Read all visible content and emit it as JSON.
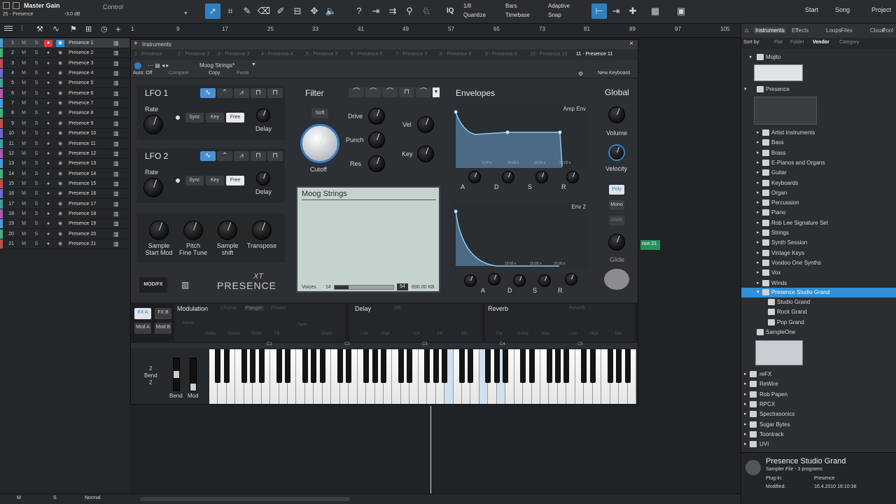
{
  "topbar": {
    "channel": "Master Gain",
    "track": "25 - Presence",
    "db": "-3.0 dB",
    "control": "Control",
    "quantize_val": "1/8",
    "quantize": "Quantize",
    "timebase_val": "Bars",
    "timebase": "Timebase",
    "snap_val": "Adaptive",
    "snap": "Snap",
    "iq": "IQ",
    "start": "Start",
    "song": "Song",
    "project": "Project"
  },
  "ruler": [
    "1",
    "9",
    "17",
    "25",
    "33",
    "41",
    "49",
    "57",
    "65",
    "73",
    "81",
    "89",
    "97",
    "105"
  ],
  "tracks": [
    "Presence 1",
    "Presence 2",
    "Presence 3",
    "Presence 4",
    "Presence 5",
    "Presence 6",
    "Presence 7",
    "Presence 8",
    "Presence 9",
    "Presence 10",
    "Presence 11",
    "Presence 12",
    "Presence 13",
    "Presence 14",
    "Presence 15",
    "Presence 16",
    "Presence 17",
    "Presence 18",
    "Presence 19",
    "Presence 20",
    "Presence 21"
  ],
  "track_nums": [
    "1",
    "2",
    "3",
    "4",
    "5",
    "6",
    "7",
    "8",
    "9",
    "10",
    "11",
    "12",
    "13",
    "14",
    "15",
    "16",
    "17",
    "18",
    "19",
    "20",
    "21"
  ],
  "instwin": {
    "title": "Instruments",
    "tabs": [
      "1 - Presence",
      "2 - Presence 2",
      "3 - Presence 3",
      "4 - Presence 4",
      "5 - Presence 5",
      "6 - Presence 6",
      "7 - Presence 7",
      "8 - Presence 8",
      "9 - Presence 9",
      "10 - Presence 10",
      "11 - Presence 11"
    ],
    "preset": "Moog Strings*",
    "auto_off": "Auto: Off",
    "compare": "Compare",
    "copy": "Copy",
    "paste": "Paste",
    "new_keyboard": "New Keyboard"
  },
  "lfo1": {
    "title": "LFO 1",
    "rate": "Rate",
    "sync": "Sync",
    "key": "Key",
    "free": "Free",
    "delay": "Delay"
  },
  "lfo2": {
    "title": "LFO 2",
    "rate": "Rate",
    "sync": "Sync",
    "key": "Key",
    "free": "Free",
    "delay": "Delay"
  },
  "sample": {
    "start_mod": "Sample\nStart Mod",
    "pitch": "Pitch\nFine Tune",
    "shift": "Sample\nshift",
    "transpose": "Transpose"
  },
  "filter": {
    "title": "Filter",
    "soft": "Soft",
    "drive": "Drive",
    "punch": "Punch",
    "res": "Res",
    "cutoff": "Cutoff",
    "vel": "Vel",
    "key": "Key"
  },
  "display": {
    "name": "Moog Strings",
    "voices_label": "Voices",
    "voices": "14",
    "voices_max": "64",
    "size": "690.00 KB"
  },
  "brand": {
    "modfx": "MOD/FX",
    "xt": "XT",
    "presence": "PRESENCE"
  },
  "envelopes": {
    "title": "Envelopes",
    "amp": "Amp Env",
    "env2": "Env 2",
    "ticks": [
      "5.00 s",
      "10.00 s",
      "15.00 s",
      "20.00 s"
    ],
    "a": "A",
    "d": "D",
    "s": "S",
    "r": "R"
  },
  "global": {
    "title": "Global",
    "volume": "Volume",
    "velocity": "Velocity",
    "poly": "Poly",
    "mono": "Mono",
    "glide": "Glide",
    "glide2": "Glide"
  },
  "fx": {
    "fxa": "FX A",
    "fxb": "FX B",
    "moda": "Mod A",
    "modb": "Mod B",
    "modulation": "Modulation",
    "chorus": "Chorus",
    "flanger": "Flanger",
    "phaser": "Phaser",
    "mod_knobs": [
      "Mono",
      "Delay",
      "Speed",
      "Width",
      "FB",
      "Depth"
    ],
    "sync": "Sync",
    "delay": "Delay",
    "delay_off": "Off",
    "delay_knobs": [
      "Low",
      "High",
      "1/4",
      "FB",
      "Mix"
    ],
    "reverb": "Reverb",
    "rev_mode": "Reverb",
    "rev_knobs": [
      "Pre",
      "Damp",
      "Size",
      "Low",
      "High",
      "Mix"
    ]
  },
  "keyboard": {
    "bend_range_top": "2",
    "bend_range_label": "Bend",
    "bend_range_bottom": "2",
    "bend": "Bend",
    "mod": "Mod",
    "octaves": [
      "C1",
      "C2",
      "C3",
      "C4",
      "C5"
    ]
  },
  "arrange": {
    "clip": "nce 21"
  },
  "browser": {
    "tabs": [
      "Instruments",
      "Effects",
      "Loops",
      "Files",
      "Cloud",
      "Pool"
    ],
    "sortby": "Sort by:",
    "flat": "Flat",
    "folder": "Folder",
    "vendor": "Vendor",
    "category": "Category",
    "mojito": "Mojito",
    "presence": "Presence",
    "folders": [
      "Artist Instruments",
      "Bass",
      "Brass",
      "E-Pianos and Organs",
      "Guitar",
      "Keyboards",
      "Organ",
      "Percussion",
      "Piano",
      "Rob Lee Signature Set",
      "Strings",
      "Synth Session",
      "Vintage Keys",
      "Voodoo One Synths",
      "Vox",
      "Winds"
    ],
    "selected": "Presence Studio Grand",
    "children": [
      "Studio Grand",
      "Rock Grand",
      "Pop Grand"
    ],
    "sampleone": "SampleOne",
    "vendors": [
      "reFX",
      "ReWire",
      "Rob Papen",
      "RPCX",
      "Spectrasonics",
      "Sugar Bytes",
      "Toontrack",
      "UVI"
    ],
    "info_title": "Presence Studio Grand",
    "info_sub": "Sampler File - 3 programs",
    "plugin_label": "Plug-in:",
    "plugin_val": "Presence",
    "modified_label": "Modified:",
    "modified_val": "16.4.2010 18:10:38"
  },
  "bottombar": {
    "m": "M",
    "s": "S",
    "normal": "Normal"
  },
  "colors": {
    "accent": "#2f7fc0",
    "selected_row": "#2f8fd8",
    "record": "#e23b3b",
    "clip": "#3fb37a"
  }
}
